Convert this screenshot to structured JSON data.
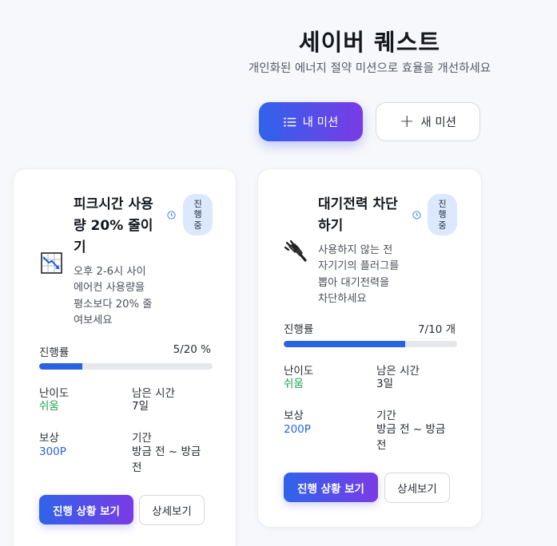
{
  "header": {
    "title": "세이버 퀘스트",
    "subtitle": "개인화된 에너지 절약 미션으로 효율을 개선하세요"
  },
  "tabs": {
    "my_missions": {
      "label": "내 미션",
      "icon": "list-icon"
    },
    "new_mission": {
      "label": "새 미션",
      "icon": "plus-icon"
    }
  },
  "missions": [
    {
      "icon": "chart-down-icon",
      "title_lines": [
        "피크시간 사용",
        "량 20% 줄이",
        "기"
      ],
      "status_lines": [
        "진",
        "행",
        "중"
      ],
      "description_lines": [
        "오후 2-6시 사이",
        "에어컨 사용량을",
        "평소보다 20% 줄",
        "여보세요"
      ],
      "progress_label": "진행률",
      "progress_text": "5/20 %",
      "progress_fraction": 0.25,
      "difficulty_label": "난이도",
      "difficulty": "쉬움",
      "remaining_label": "남은 시간",
      "remaining": "7일",
      "reward_label": "보상",
      "reward": "300P",
      "period_label": "기간",
      "period_lines": [
        "방금 전 ~ 방금",
        "전"
      ],
      "view_progress_label": "진행 상황 보기",
      "details_label": "상세보기"
    },
    {
      "icon": "plug-icon",
      "title_lines": [
        "대기전력 차단",
        "하기"
      ],
      "status_lines": [
        "진",
        "행",
        "중"
      ],
      "description_lines": [
        "사용하지 않는 전",
        "자기기의 플러그를",
        "뽑아 대기전력을",
        "차단하세요"
      ],
      "progress_label": "진행률",
      "progress_text": "7/10 개",
      "progress_fraction": 0.7,
      "difficulty_label": "난이도",
      "difficulty": "쉬움",
      "remaining_label": "남은 시간",
      "remaining": "3일",
      "reward_label": "보상",
      "reward": "200P",
      "period_label": "기간",
      "period_lines": [
        "방금 전 ~ 방금",
        "전"
      ],
      "view_progress_label": "진행 상황 보기",
      "details_label": "상세보기"
    }
  ],
  "colors": {
    "accent_start": "#2f63ea",
    "accent_end": "#7a3be6",
    "progress": "#2a63e0",
    "difficulty_easy": "#16a34a",
    "reward": "#2563eb",
    "badge_bg": "#dbe8fe"
  }
}
